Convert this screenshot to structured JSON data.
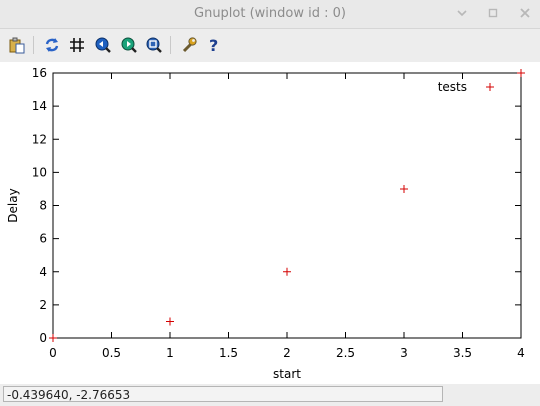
{
  "window": {
    "title": "Gnuplot (window id : 0)"
  },
  "toolbar": {
    "buttons": [
      {
        "name": "copy-clipboard-icon"
      },
      {
        "name": "replot-icon"
      },
      {
        "name": "grid-icon"
      },
      {
        "name": "zoom-previous-icon"
      },
      {
        "name": "zoom-next-icon"
      },
      {
        "name": "autoscale-icon"
      },
      {
        "name": "settings-wrench-icon"
      },
      {
        "name": "help-icon"
      }
    ]
  },
  "status": {
    "coordinates": "-0.439640, -2.76653"
  },
  "chart_data": {
    "type": "scatter",
    "xlabel": "start",
    "ylabel": "Delay",
    "xlim": [
      0,
      4
    ],
    "ylim": [
      0,
      16
    ],
    "xticks": [
      "0",
      "0.5",
      "1",
      "1.5",
      "2",
      "2.5",
      "3",
      "3.5",
      "4"
    ],
    "yticks": [
      "0",
      "2",
      "4",
      "6",
      "8",
      "10",
      "12",
      "14",
      "16"
    ],
    "grid": false,
    "legend_position": "top-right",
    "series": [
      {
        "name": "tests",
        "color": "#d40000",
        "marker": "+",
        "x": [
          0,
          1,
          2,
          3,
          4
        ],
        "y": [
          0,
          1,
          4,
          9,
          16
        ]
      }
    ]
  }
}
